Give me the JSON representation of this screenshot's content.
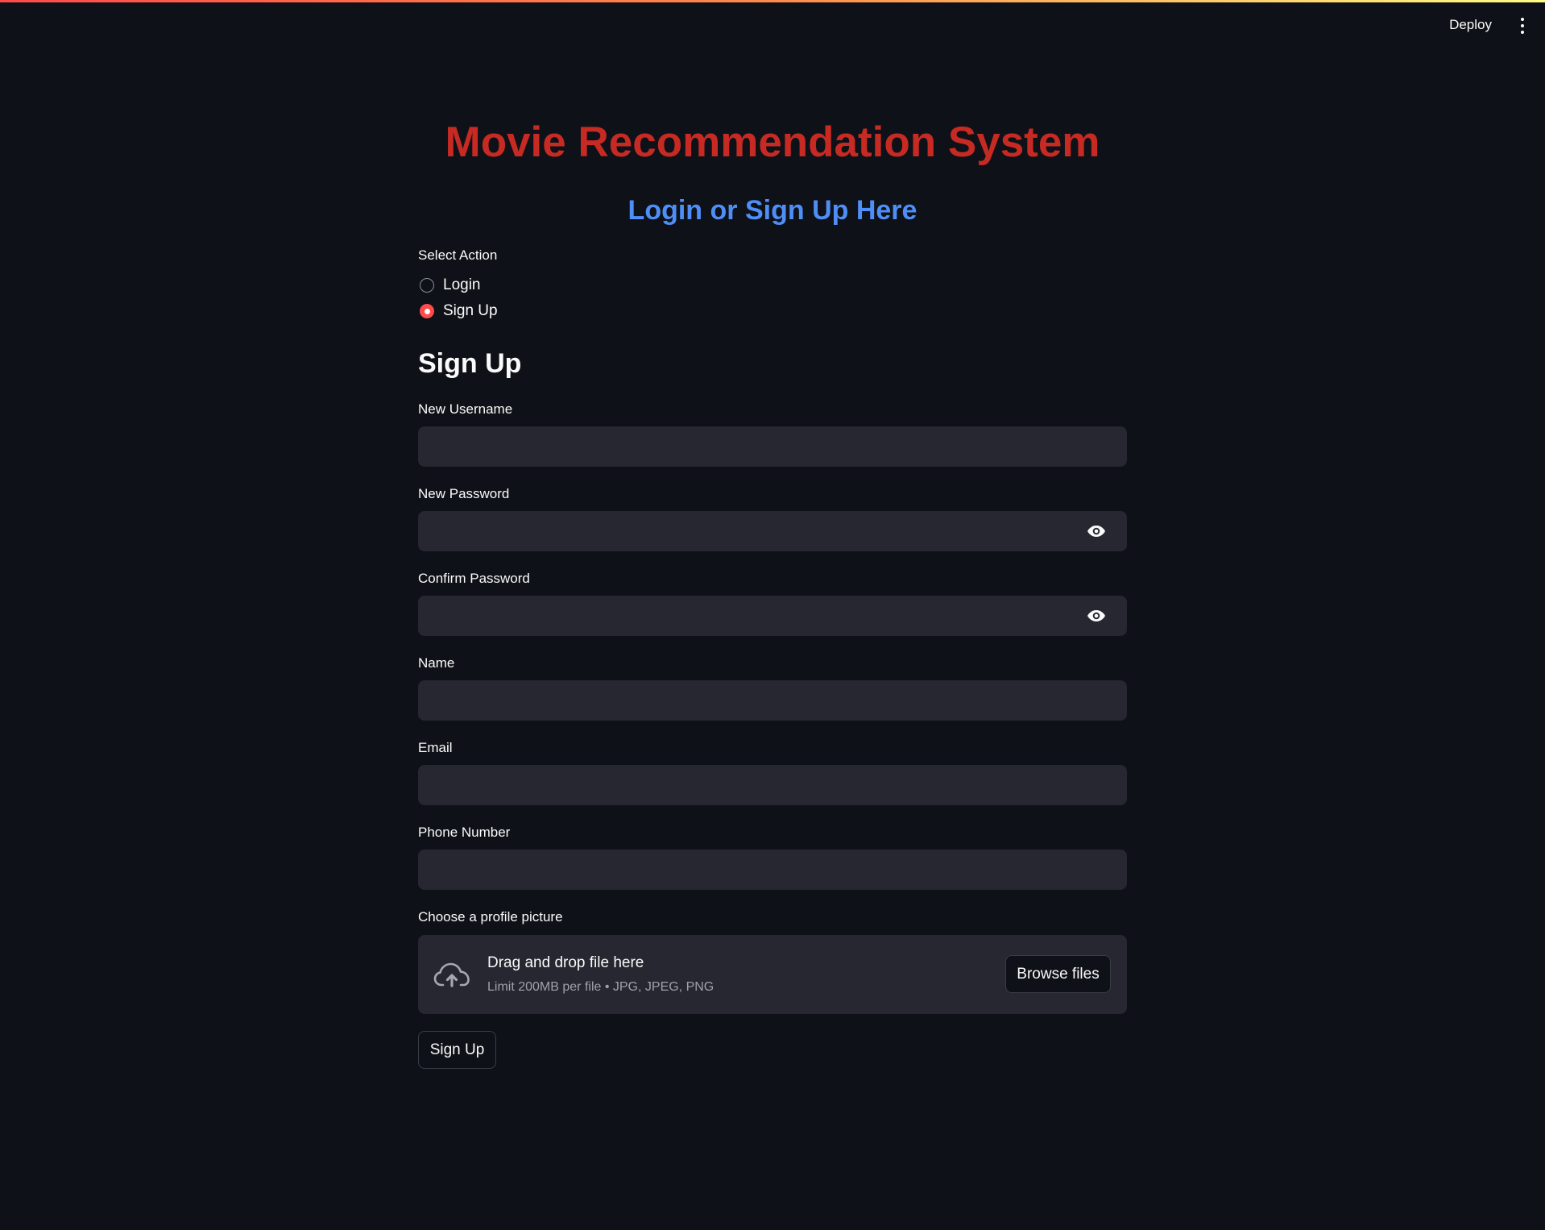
{
  "header": {
    "deploy_label": "Deploy",
    "menu_icon": "more-vertical-icon"
  },
  "page": {
    "title": "Movie Recommendation System",
    "subtitle": "Login or Sign Up Here"
  },
  "action_select": {
    "label": "Select Action",
    "options": [
      {
        "label": "Login",
        "selected": false
      },
      {
        "label": "Sign Up",
        "selected": true
      }
    ]
  },
  "signup": {
    "heading": "Sign Up",
    "fields": {
      "username": {
        "label": "New Username",
        "value": ""
      },
      "password": {
        "label": "New Password",
        "value": ""
      },
      "confirm_password": {
        "label": "Confirm Password",
        "value": ""
      },
      "name": {
        "label": "Name",
        "value": ""
      },
      "email": {
        "label": "Email",
        "value": ""
      },
      "phone": {
        "label": "Phone Number",
        "value": ""
      }
    },
    "uploader": {
      "label": "Choose a profile picture",
      "title": "Drag and drop file here",
      "hint": "Limit 200MB per file • JPG, JPEG, PNG",
      "browse_label": "Browse files",
      "icon": "cloud-upload-icon"
    },
    "submit_label": "Sign Up"
  },
  "colors": {
    "background": "#0e1117",
    "title": "#c62a23",
    "subtitle": "#4f8ef7",
    "accent": "#ff4b4b",
    "input_background": "#262730"
  }
}
